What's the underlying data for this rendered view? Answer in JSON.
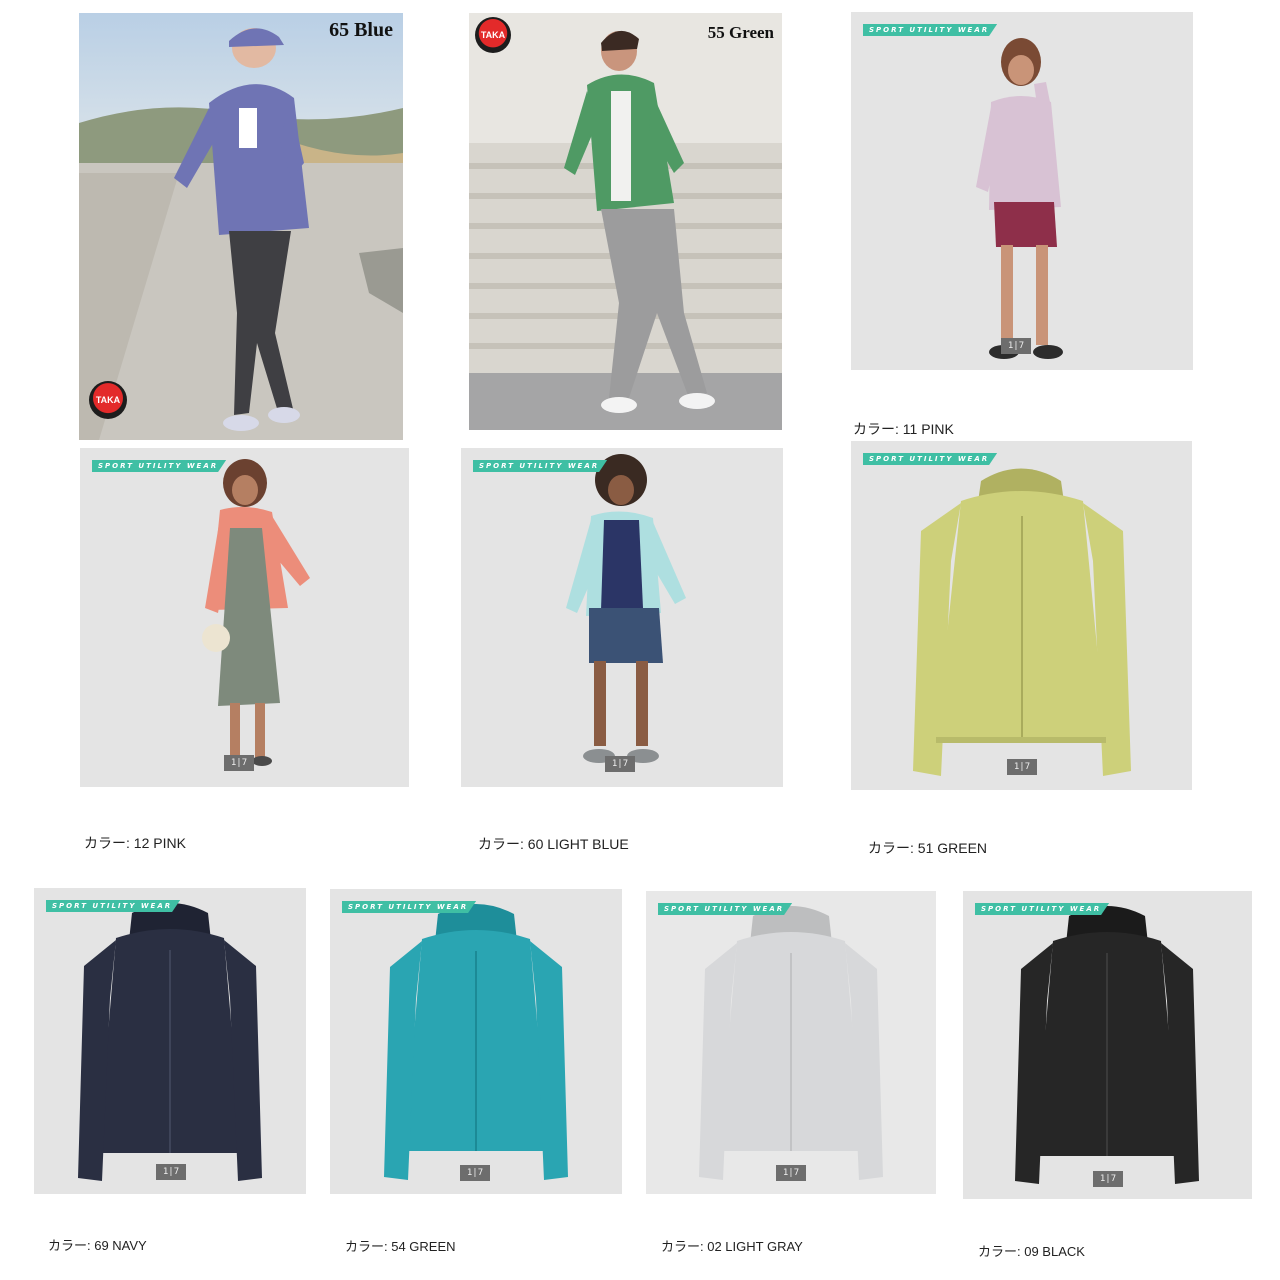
{
  "photo_cards": [
    {
      "label": "65 Blue",
      "logo": "TAKA"
    },
    {
      "label": "55 Green",
      "logo": "TAKA"
    },
    {
      "tag": "SPORT UTILITY WEAR",
      "counter": "1|7",
      "caption": "カラー:  11 PINK"
    }
  ],
  "model_cards": [
    {
      "tag": "SPORT UTILITY WEAR",
      "counter": "1|7",
      "caption": "カラー:  12 PINK"
    },
    {
      "tag": "SPORT UTILITY WEAR",
      "counter": "1|7",
      "caption": "カラー:  60 LIGHT BLUE"
    },
    {
      "tag": "SPORT UTILITY WEAR",
      "counter": "1|7",
      "caption": "カラー:  51 GREEN"
    }
  ],
  "product_cards": [
    {
      "tag": "SPORT UTILITY WEAR",
      "counter": "1|7",
      "caption": "カラー:  69 NAVY"
    },
    {
      "tag": "SPORT UTILITY WEAR",
      "counter": "1|7",
      "caption": "カラー:  54 GREEN"
    },
    {
      "tag": "SPORT UTILITY WEAR",
      "counter": "1|7",
      "caption": "カラー:  02 LIGHT GRAY"
    },
    {
      "tag": "SPORT UTILITY WEAR",
      "counter": "1|7",
      "caption": "カラー:  09 BLACK"
    }
  ],
  "colors": {
    "blue": "#6f74b4",
    "green_photo": "#4f9a64",
    "pink_light": "#d8c2d4",
    "coral": "#ec8d7a",
    "light_blue": "#aedfe0",
    "lime": "#cdd07a",
    "navy": "#2a2f42",
    "teal": "#2aa5b2",
    "light_gray": "#d7d8da",
    "black": "#262626",
    "tag_accent": "#3fbfa4"
  }
}
